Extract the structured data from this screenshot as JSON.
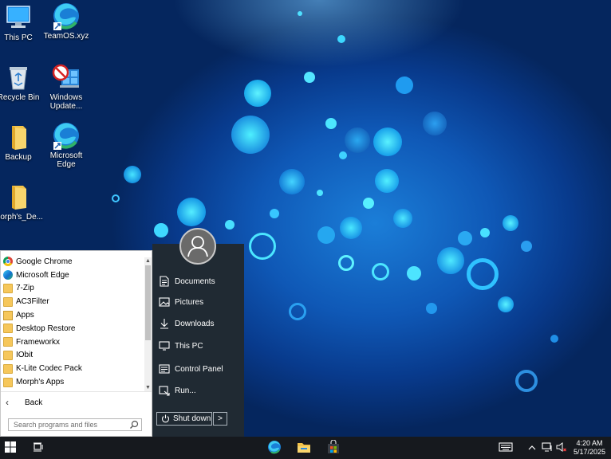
{
  "desktop": {
    "icons": [
      {
        "label": "This PC"
      },
      {
        "label": "TeamOS.xyz"
      },
      {
        "label": "Recycle Bin"
      },
      {
        "label": "Windows Update..."
      },
      {
        "label": "Backup"
      },
      {
        "label": "Microsoft Edge"
      },
      {
        "label": "Morph's_De..."
      }
    ]
  },
  "start_menu": {
    "programs": [
      {
        "label": "Google Chrome",
        "icon": "chrome-icon"
      },
      {
        "label": "Microsoft Edge",
        "icon": "edge-icon"
      },
      {
        "label": "7-Zip",
        "icon": "folder-icon"
      },
      {
        "label": "AC3Filter",
        "icon": "folder-icon"
      },
      {
        "label": "Apps",
        "icon": "apps-icon"
      },
      {
        "label": "Desktop Restore",
        "icon": "folder-icon"
      },
      {
        "label": "Frameworkx",
        "icon": "folder-icon"
      },
      {
        "label": "IObit",
        "icon": "folder-icon"
      },
      {
        "label": "K-Lite Codec Pack",
        "icon": "folder-icon"
      },
      {
        "label": "Morph's Apps",
        "icon": "folder-icon"
      }
    ],
    "back_label": "Back",
    "search_placeholder": "Search programs and files",
    "right_items": [
      {
        "label": "Documents",
        "icon": "document-icon"
      },
      {
        "label": "Pictures",
        "icon": "picture-icon"
      },
      {
        "label": "Downloads",
        "icon": "download-icon"
      },
      {
        "label": "This PC",
        "icon": "monitor-icon"
      },
      {
        "label": "Control Panel",
        "icon": "control-panel-icon"
      },
      {
        "label": "Run...",
        "icon": "run-icon"
      }
    ],
    "shutdown_label": "Shut down",
    "shutdown_arrow": ">"
  },
  "taskbar": {
    "pinned": [
      "edge-icon",
      "file-explorer-icon",
      "store-icon"
    ],
    "tray": [
      "keyboard-icon",
      "chevron-up-icon",
      "network-icon",
      "speaker-muted-icon"
    ],
    "time": "4:20 AM",
    "date": "5/17/2025"
  },
  "colors": {
    "wallpaper": "#0f58b6",
    "start_right_panel": "#202a33",
    "taskbar": "#16191e"
  }
}
